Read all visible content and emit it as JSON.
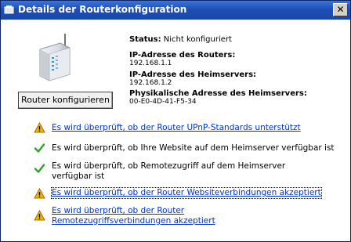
{
  "window": {
    "title": "Details der Routerkonfiguration",
    "close_glyph": "✕"
  },
  "status": {
    "label": "Status:",
    "value": "Nicht konfiguriert"
  },
  "router_ip": {
    "label": "IP-Adresse des Routers:",
    "value": "192.168.1.1"
  },
  "server_ip": {
    "label": "IP-Adresse des Heimservers:",
    "value": "192.168.1.2"
  },
  "mac": {
    "label": "Physikalische Adresse des Heimservers:",
    "value": "00-E0-4D-41-F5-34"
  },
  "configure_button": "Router konfigurieren",
  "checks": [
    {
      "icon": "warning-icon",
      "text": "Es wird überprüft, ob der Router UPnP-Standards unterstützt",
      "link": true
    },
    {
      "icon": "checkmark-icon",
      "text": "Es wird überprüft, ob Ihre Website auf dem Heimserver verfügbar ist",
      "link": false
    },
    {
      "icon": "checkmark-icon",
      "text": "Es wird überprüft, ob Remotezugriff auf dem Heimserver verfügbar ist",
      "link": false
    },
    {
      "icon": "warning-icon",
      "text": "Es wird überprüft, ob der Router Websiteverbindungen akzeptiert",
      "link": true
    },
    {
      "icon": "warning-icon",
      "text": "Es wird überprüft, ob der Router Remotezugriffsverbindungen akzeptiert",
      "link": true
    }
  ],
  "colors": {
    "titlebar": "#1f4fb5",
    "link": "#0033cc",
    "warning": "#f5b400",
    "check": "#2fa32f"
  }
}
